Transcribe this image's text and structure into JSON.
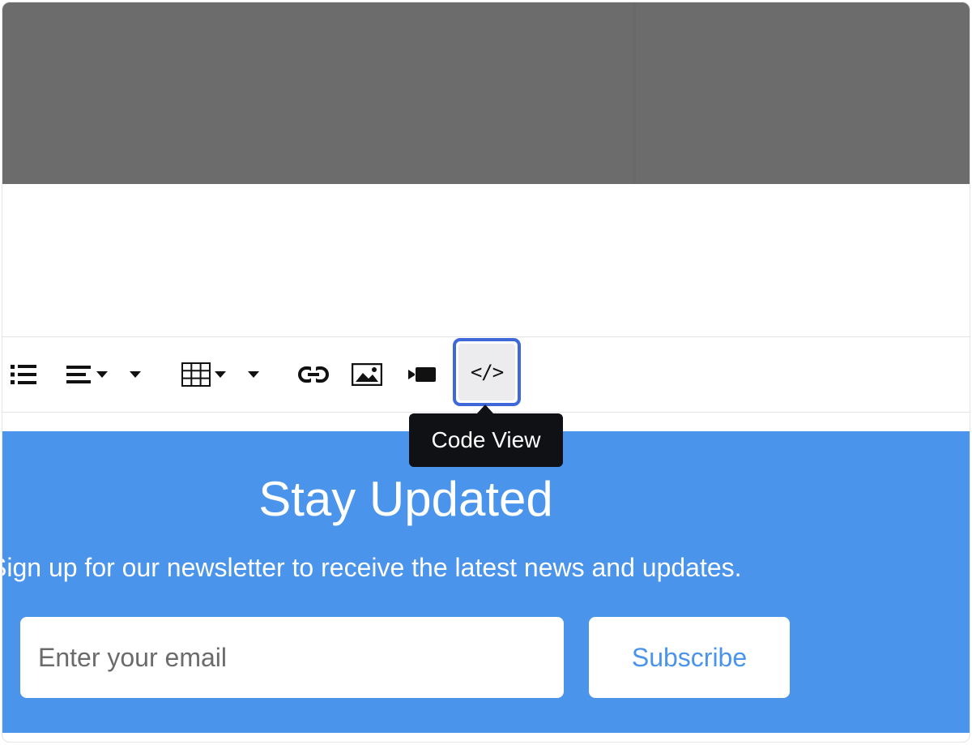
{
  "toolbar": {
    "buttons": [
      {
        "name": "unordered-list",
        "icon": "list-icon"
      },
      {
        "name": "paragraph-align",
        "icon": "align-left-icon",
        "dropdown": true
      },
      {
        "name": "more-dropdown",
        "icon": "caret-down-icon"
      },
      {
        "name": "table",
        "icon": "table-icon",
        "dropdown": true
      },
      {
        "name": "more-dropdown-2",
        "icon": "caret-down-icon"
      },
      {
        "name": "link",
        "icon": "link-icon"
      },
      {
        "name": "picture",
        "icon": "image-icon"
      },
      {
        "name": "video",
        "icon": "video-icon"
      },
      {
        "name": "code-view",
        "icon": "code-icon",
        "label": "</>",
        "active": true
      }
    ],
    "tooltip": "Code View"
  },
  "newsletter": {
    "title": "Stay Updated",
    "description": "Sign up for our newsletter to receive the latest news and updates.",
    "email_placeholder": "Enter your email",
    "subscribe_label": "Subscribe",
    "background_color": "#4a94eb"
  },
  "colors": {
    "header_band": "#6c6c6c",
    "focus_ring": "#3f68d8",
    "tooltip_bg": "#0f1115"
  }
}
